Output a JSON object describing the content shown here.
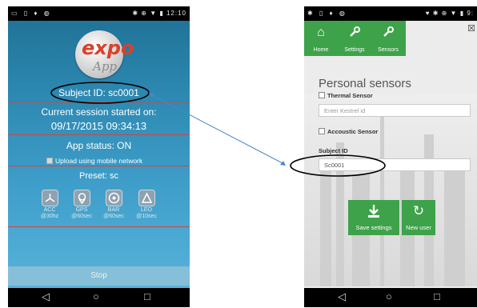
{
  "left_phone": {
    "status_time": "12:10",
    "logo": {
      "word1": "expo",
      "word2": "App"
    },
    "subject_id": "Subject ID:  sc0001",
    "session_label": "Current session started on:",
    "session_datetime": "09/17/2015 09:34:13",
    "app_status": "App status:  ON",
    "upload_label": "Upload using mobile network",
    "preset": "Preset:  sc",
    "sensors": [
      {
        "name": "ACC",
        "rate": "@30hz",
        "icon": "accelerometer-icon"
      },
      {
        "name": "GPS",
        "rate": "@60sec",
        "icon": "gps-pin-icon"
      },
      {
        "name": "BAR",
        "rate": "@60sec",
        "icon": "barometer-icon"
      },
      {
        "name": "LEO",
        "rate": "@10sec",
        "icon": "leo-icon"
      }
    ],
    "stop_label": "Stop"
  },
  "right_phone": {
    "status_time": "9:",
    "tabs": [
      {
        "label": "Home",
        "icon": "home-icon"
      },
      {
        "label": "Settings",
        "icon": "wrench-icon"
      },
      {
        "label": "Sensors",
        "icon": "wrench-icon"
      }
    ],
    "title": "Personal sensors",
    "thermal_label": "Thermal Sensor",
    "kestrel_placeholder": "Enter Kestrel id",
    "accoustic_label": "Accoustic Sensor",
    "subject_id_label": "Subject ID",
    "subject_id_value": "Sc0001",
    "save_label": "Save settings",
    "new_user_label": "New user"
  },
  "colors": {
    "accent_green": "#3ea24a",
    "annotation_blue": "#4a86c6",
    "divider_red": "#d3463e"
  }
}
